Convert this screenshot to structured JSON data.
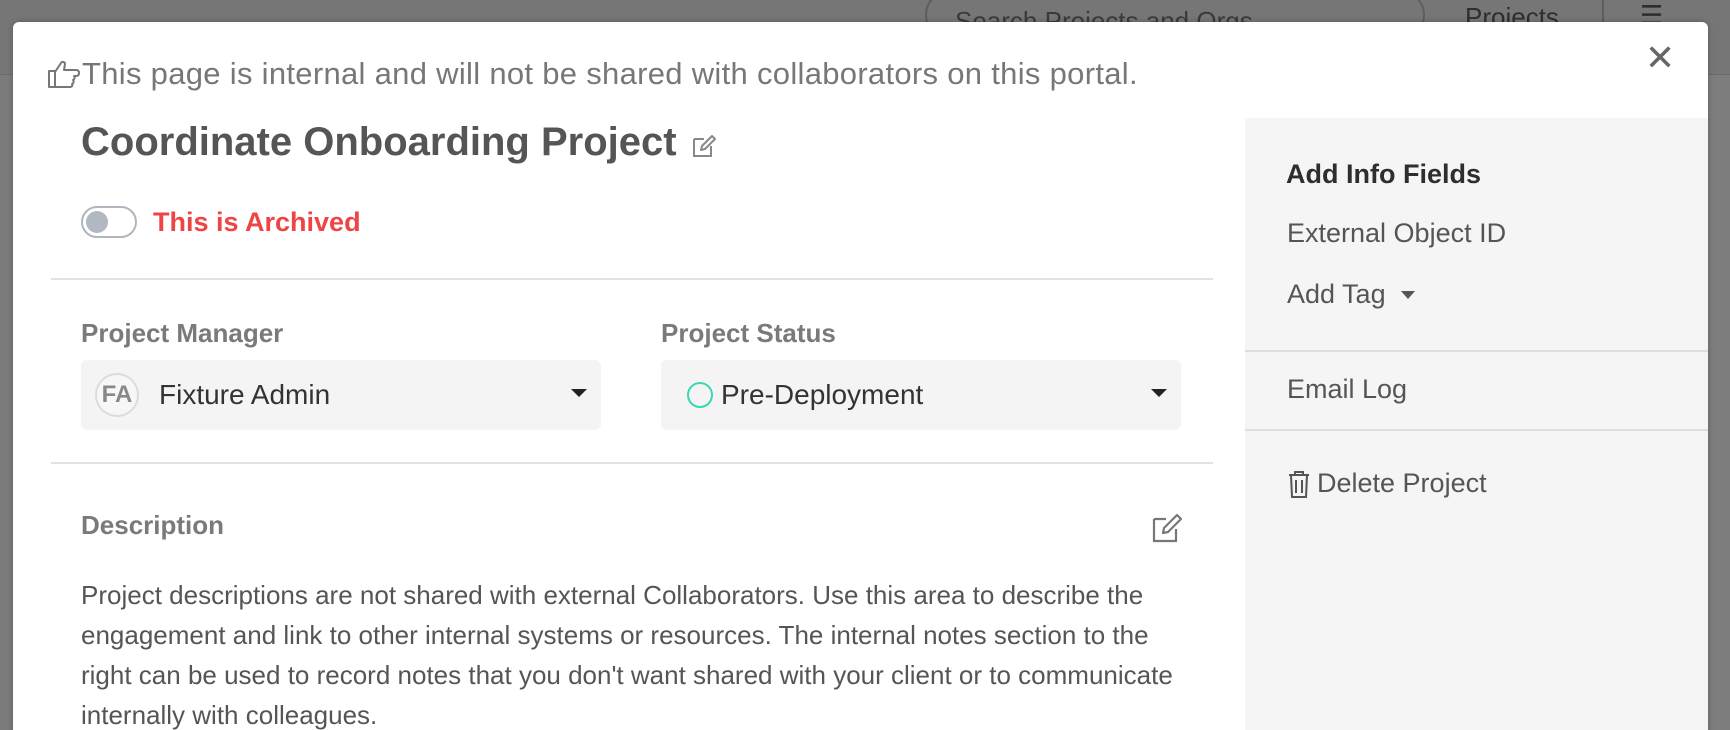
{
  "background": {
    "search_placeholder": "Search Projects and Orgs",
    "projects_label": "Projects"
  },
  "banner": {
    "icon": "hand-pointing-icon",
    "text": "This page is internal and will not be shared with collaborators on this portal."
  },
  "project": {
    "title": "Coordinate Onboarding Project",
    "archived_label": "This is Archived",
    "archived_on": false
  },
  "fields": {
    "manager_label": "Project Manager",
    "manager_initials": "FA",
    "manager_value": "Fixture Admin",
    "status_label": "Project Status",
    "status_value": "Pre-Deployment"
  },
  "description": {
    "label": "Description",
    "text": "Project descriptions are not shared with external Collaborators. Use this area to describe the engagement and link to other internal systems or resources. The internal notes section to the right can be used to record notes that you don't want shared with your client or to communicate internally with colleagues."
  },
  "side_panel": {
    "heading": "Add Info Fields",
    "external_id": "External Object ID",
    "add_tag": "Add Tag",
    "email_log": "Email Log",
    "delete_project": "Delete Project"
  },
  "colors": {
    "archived_red": "#ef4444",
    "status_teal": "#3dd6b5",
    "panel_bg": "#f5f5f5"
  }
}
